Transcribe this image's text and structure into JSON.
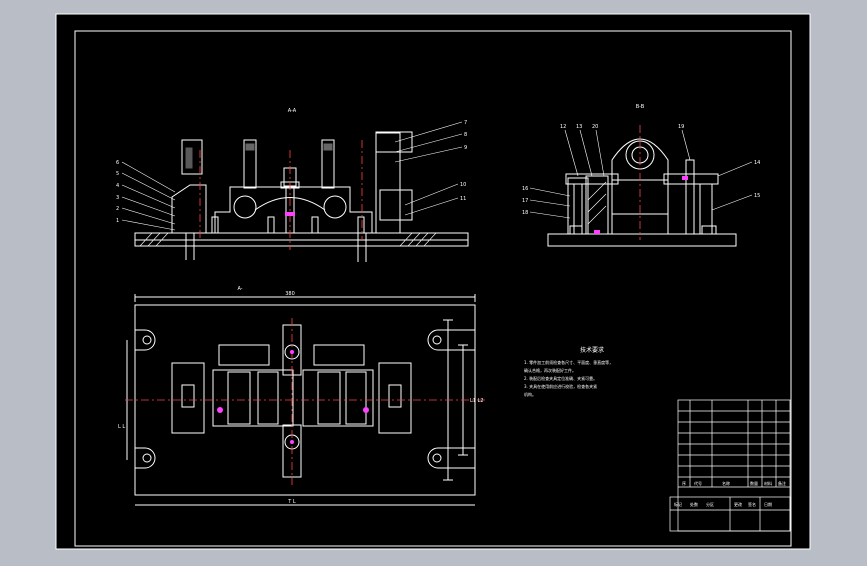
{
  "drawing": {
    "colors": {
      "background": "#b9bdc5",
      "sheet": "#000000",
      "line": "#ffffff",
      "centerline": "#ff4040",
      "highlight": "#ff40ff"
    },
    "section_labels": {
      "front": "A-A",
      "side": "B-B",
      "plan": "A-"
    },
    "front_view_callouts": [
      "7",
      "8",
      "9",
      "6",
      "5",
      "4",
      "3",
      "2",
      "1",
      "10",
      "11"
    ],
    "side_view_callouts": [
      "12",
      "13",
      "20",
      "19",
      "14",
      "15",
      "16",
      "17",
      "18"
    ],
    "dimensions": {
      "plan_width": "380",
      "plan_bottom": "T L",
      "plan_left": "L L",
      "plan_right": "L1 L2"
    },
    "technical_requirements": {
      "title": "技术要求",
      "lines": [
        "1. 零件加工前须检查各尺寸、平面度、垂直度等，",
        "   确认合格，再次装配好工件。",
        "2. 装配后检查夹具定位准确、夹紧可靠。",
        "3. 夹具在使用前应进行校验，检查各夹紧",
        "   机构。"
      ]
    },
    "title_block": {
      "header": [
        "序",
        "代号",
        "名称",
        "数量",
        "材料",
        "备注"
      ],
      "bottom_row": [
        "标记",
        "处数",
        "分区",
        "更改",
        "签名",
        "日期"
      ]
    }
  }
}
